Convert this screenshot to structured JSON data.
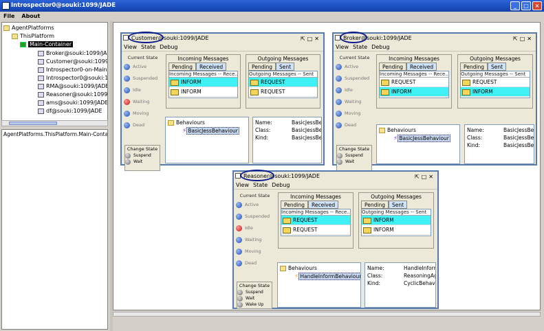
{
  "window": {
    "title": "Introspector0@souki:1099/JADE",
    "icon": "jade-icon",
    "buttons": [
      "minimize",
      "maximize",
      "close"
    ]
  },
  "menu": [
    "File",
    "About"
  ],
  "tree": {
    "root": "AgentPlatforms",
    "platform": "ThisPlatform",
    "container": "Main-Container",
    "agents": [
      "Broker@souki:1099/JA",
      "Customer@souki:1099",
      "Introspector0-on-Main-",
      "Introspector0@souki:1(",
      "RMA@souki:1099/JADE",
      "Reasoner@souki:1099/",
      "ams@souki:1099/JADE",
      "df@souki:1099/JADE"
    ]
  },
  "status_text": "AgentPlatforms.ThisPlatform.Main-Container",
  "frame_common": {
    "menu": [
      "View",
      "State",
      "Debug"
    ],
    "current_state_label": "Current State",
    "states": [
      "Active",
      "Suspended",
      "Idle",
      "Waiting",
      "Moving",
      "Dead"
    ],
    "change_state_label": "Change State",
    "change_buttons": [
      "Suspend",
      "Wait",
      "Wake Up"
    ],
    "incoming_label": "Incoming Messages",
    "outgoing_label": "Outgoing Messages",
    "tab_pending": "Pending",
    "tab_received": "Received",
    "tab_sent": "Sent",
    "incoming_header": "Incoming Messages -- Rece...",
    "outgoing_header": "Outgoing Messages -- Sent",
    "behaviours_label": "Behaviours",
    "prop_name": "Name:",
    "prop_class": "Class:",
    "prop_kind": "Kind:"
  },
  "frames": [
    {
      "agent": "Customer",
      "title_rest": "@souki:1099/JADE",
      "active_state_dot": "red",
      "incoming": [
        "INFORM",
        "INFORM"
      ],
      "outgoing": [
        "REQUEST",
        "REQUEST"
      ],
      "behaviour": "BasicJessBehaviour",
      "props": {
        "name": "BasicJessBe",
        "class": "BasicJessBe",
        "kind": "BasicJessBe"
      }
    },
    {
      "agent": "Broker",
      "title_rest": "@souki:1099/JADE",
      "active_state_dot": "none",
      "incoming": [
        "REQUEST",
        "INFORM"
      ],
      "outgoing": [
        "REQUEST",
        "INFORM"
      ],
      "behaviour": "BasicJessBehaviour",
      "props": {
        "name": "BasicJessBe",
        "class": "BasicJessBe",
        "kind": "BasicJessBe"
      }
    },
    {
      "agent": "Reasoner",
      "title_rest": "@souki:1099/JADE",
      "active_state_dot": "red-idle",
      "incoming": [
        "REQUEST",
        "REQUEST"
      ],
      "outgoing": [
        "INFORM",
        "INFORM"
      ],
      "behaviour": "HandleInformBehaviour",
      "props": {
        "name": "HandleInform",
        "class": "ReasoningAg",
        "kind": "CyclicBehavio"
      }
    }
  ],
  "colors": {
    "titlebar": "#2c63d6",
    "highlight_row": "#3ff0f5",
    "frame_border": "#5779b1",
    "agent_outline": "#0d1a8c"
  }
}
